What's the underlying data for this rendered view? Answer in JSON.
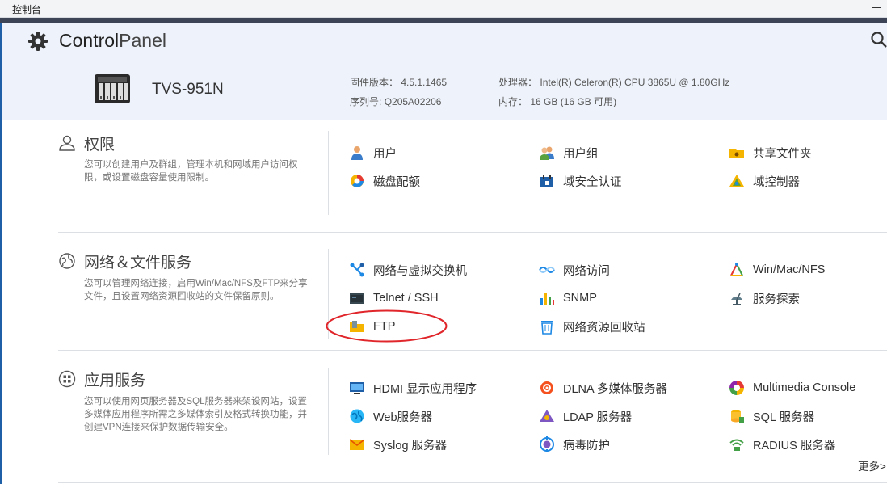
{
  "window": {
    "title": "控制台"
  },
  "header": {
    "app_name_bold": "Control",
    "app_name_rest": "Panel",
    "model": "TVS-951N",
    "firmware_label": "固件版本：",
    "firmware_value": "4.5.1.1465",
    "serial_label": "序列号:",
    "serial_value": "Q205A02206",
    "cpu_label": "处理器：",
    "cpu_value": "Intel(R) Celeron(R) CPU 3865U @ 1.80GHz",
    "memory_label": "内存：",
    "memory_value": "16 GB (16 GB 可用)"
  },
  "sections": [
    {
      "title": "权限",
      "description": "您可以创建用户及群组，管理本机和网域用户访问权限，或设置磁盘容量使用限制。",
      "items": [
        {
          "label": "用户",
          "icon": "user-icon"
        },
        {
          "label": "用户组",
          "icon": "user-group-icon"
        },
        {
          "label": "共享文件夹",
          "icon": "shared-folder-icon"
        },
        {
          "label": "磁盘配额",
          "icon": "disk-quota-icon"
        },
        {
          "label": "域安全认证",
          "icon": "domain-security-icon"
        },
        {
          "label": "域控制器",
          "icon": "domain-controller-icon"
        }
      ]
    },
    {
      "title": "网络＆文件服务",
      "description": "您可以管理网络连接，启用Win/Mac/NFS及FTP来分享文件，且设置网络资源回收站的文件保留原则。",
      "items": [
        {
          "label": "网络与虚拟交换机",
          "icon": "network-switch-icon"
        },
        {
          "label": "网络访问",
          "icon": "network-access-icon"
        },
        {
          "label": "Win/Mac/NFS",
          "icon": "win-mac-nfs-icon"
        },
        {
          "label": "Telnet / SSH",
          "icon": "terminal-icon"
        },
        {
          "label": "SNMP",
          "icon": "snmp-icon"
        },
        {
          "label": "服务探索",
          "icon": "service-discovery-icon"
        },
        {
          "label": "FTP",
          "icon": "ftp-icon"
        },
        {
          "label": "网络资源回收站",
          "icon": "recycle-bin-icon"
        }
      ]
    },
    {
      "title": "应用服务",
      "description": "您可以使用网页服务器及SQL服务器来架设网站，设置多媒体应用程序所需之多媒体索引及格式转换功能，并创建VPN连接来保护数据传输安全。",
      "items": [
        {
          "label": "HDMI 显示应用程序",
          "icon": "hdmi-display-icon"
        },
        {
          "label": "DLNA 多媒体服务器",
          "icon": "dlna-icon"
        },
        {
          "label": "Multimedia Console",
          "icon": "multimedia-console-icon"
        },
        {
          "label": "Web服务器",
          "icon": "web-server-icon"
        },
        {
          "label": "LDAP 服务器",
          "icon": "ldap-icon"
        },
        {
          "label": "SQL 服务器",
          "icon": "sql-server-icon"
        },
        {
          "label": "Syslog 服务器",
          "icon": "syslog-icon"
        },
        {
          "label": "病毒防护",
          "icon": "antivirus-icon"
        },
        {
          "label": "RADIUS 服务器",
          "icon": "radius-icon"
        }
      ]
    }
  ],
  "more_link": "更多>",
  "colors": {
    "accent": "#1f5fa8",
    "header_bg": "#eef3fb",
    "highlight": "#e0262b"
  }
}
